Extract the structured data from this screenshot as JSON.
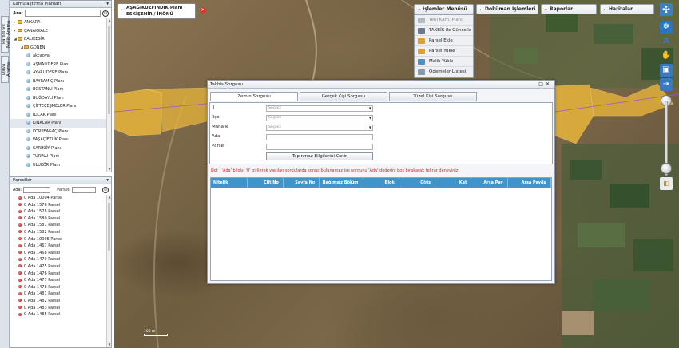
{
  "left_tabs": [
    "Parsel ve Malik Arama",
    "Dava Arama"
  ],
  "kamu": {
    "header": "Kamulaştırma Planları",
    "search_label": "Ara:",
    "tree": [
      {
        "label": "ANKARA",
        "type": "folder",
        "level": 0
      },
      {
        "label": "ÇANAKKALE",
        "type": "folder",
        "level": 0
      },
      {
        "label": "BALIKESİR",
        "type": "folder",
        "level": 0,
        "open": true
      },
      {
        "label": "GÖNEN",
        "type": "folder",
        "level": 1,
        "open": true
      },
      {
        "label": "akcaova",
        "type": "plan",
        "level": 2
      },
      {
        "label": "AŞMALIDERE Planı",
        "type": "plan",
        "level": 2
      },
      {
        "label": "AYVALIDERE Planı",
        "type": "plan",
        "level": 2
      },
      {
        "label": "BAYRAMİÇ Planı",
        "type": "plan",
        "level": 2
      },
      {
        "label": "BOSTANLI Planı",
        "type": "plan",
        "level": 2
      },
      {
        "label": "BUĞDAYLI Planı",
        "type": "plan",
        "level": 2
      },
      {
        "label": "ÇİFTEÇEŞMELER Planı",
        "type": "plan",
        "level": 2
      },
      {
        "label": "ILICAK Planı",
        "type": "plan",
        "level": 2
      },
      {
        "label": "KINALAR Planı",
        "type": "plan",
        "level": 2,
        "selected": true
      },
      {
        "label": "KÖRPEAĞAÇ Planı",
        "type": "plan",
        "level": 2
      },
      {
        "label": "PAŞAÇİFTLİK Planı",
        "type": "plan",
        "level": 2
      },
      {
        "label": "SARIKÖY Planı",
        "type": "plan",
        "level": 2
      },
      {
        "label": "TURPLU Planı",
        "type": "plan",
        "level": 2
      },
      {
        "label": "ULUKÖR Planı",
        "type": "plan",
        "level": 2
      }
    ]
  },
  "parseller": {
    "header": "Parseller",
    "ada_label": "Ada:",
    "parsel_label": "Parsel:",
    "items": [
      "0 Ada 10004 Parsel",
      "0 Ada 1576 Parsel",
      "0 Ada 1578 Parsel",
      "0 Ada 1580 Parsel",
      "0 Ada 1581 Parsel",
      "0 Ada 1582 Parsel",
      "0 Ada 10005 Parsel",
      "0 Ada 1467 Parsel",
      "0 Ada 1468 Parsel",
      "0 Ada 1470 Parsel",
      "0 Ada 1475 Parsel",
      "0 Ada 1476 Parsel",
      "0 Ada 1477 Parsel",
      "0 Ada 1478 Parsel",
      "0 Ada 1481 Parsel",
      "0 Ada 1482 Parsel",
      "0 Ada 1483 Parsel",
      "0 Ada 1485 Parsel"
    ]
  },
  "plan": {
    "line1": "AŞAĞIKUZFINDIK Planı",
    "line2": "ESKİŞEHİR / İNÖNÜ"
  },
  "toolbar": {
    "islemler": "İşlemler Menüsü",
    "dokuman": "Doküman İşlemleri",
    "raporlar": "Raporlar",
    "haritalar": "Haritalar"
  },
  "islemler_menu": [
    {
      "label": "Yeni Kam. Planı",
      "disabled": true,
      "color": "#b0b8c4"
    },
    {
      "label": "TAKBİS ile Güncelle",
      "color": "#6a7a8c"
    },
    {
      "label": "Parsel Ekle",
      "color": "#e0a030"
    },
    {
      "label": "Parsel Yükle",
      "color": "#e0a030"
    },
    {
      "label": "Malik Yükle",
      "color": "#4a90c8"
    },
    {
      "label": "Ödemeler Listesi",
      "color": "#8a9aaa"
    }
  ],
  "dialog": {
    "title": "Takbis Sorgusu",
    "tabs": [
      "Zemin Sorgusu",
      "Gerçek Kişi Sorgusu",
      "Tüzel Kişi Sorgusu"
    ],
    "fields": {
      "il": "İl",
      "ilce": "İlçe",
      "mahalle": "Mahalle",
      "ada": "Ada",
      "parsel": "Parsel",
      "placeholder": "Seçiniz"
    },
    "submit": "Tapınmaz Bilgilerini Getir",
    "note": "Not : 'Ada' bilgisi '0' girilerek yapılan sorgularda sonuç bulunamaz ise sorguyu 'Ada' değerini boş bırakarak tekrar deneyiniz.",
    "columns": [
      "Nitelik",
      "Cilt No",
      "Sayfa No",
      "Bağımsız Bölüm No",
      "Blok",
      "Giriş",
      "Kat",
      "Arsa Pay",
      "Arsa Payda"
    ]
  },
  "scale_label": "100 m"
}
